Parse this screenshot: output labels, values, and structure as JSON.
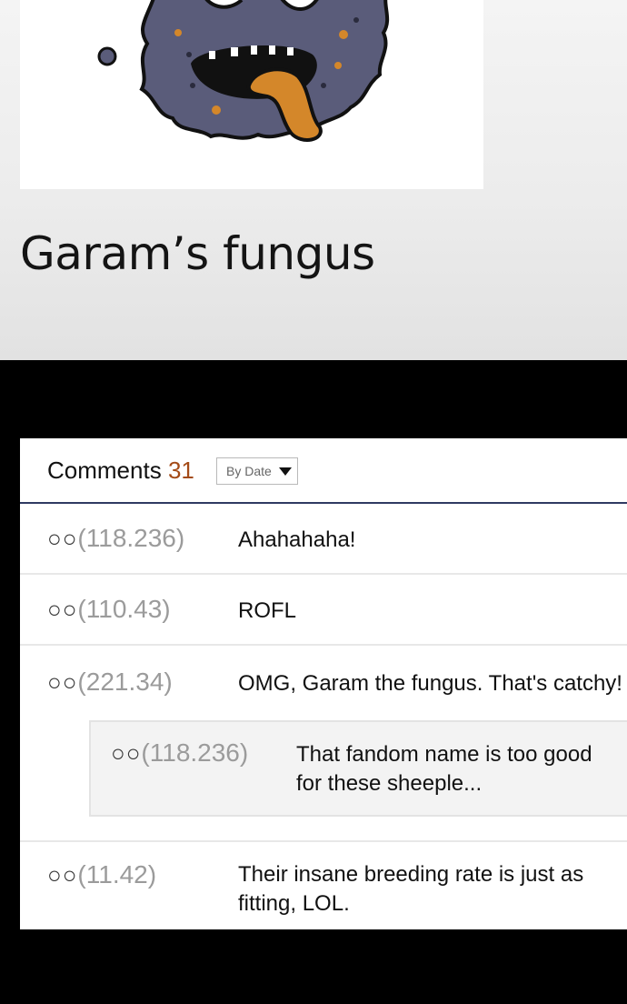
{
  "caption": "Garam’s fungus",
  "comments": {
    "title": "Comments",
    "count": "31",
    "sort_label": "By Date",
    "items": [
      {
        "circles": "○○",
        "author": "(118.236)",
        "text": "Ahahahaha!"
      },
      {
        "circles": "○○",
        "author": "(110.43)",
        "text": "ROFL"
      },
      {
        "circles": "○○",
        "author": "(221.34)",
        "text": "OMG, Garam the fungus. That's catchy!"
      },
      {
        "circles": "○○",
        "author": "(11.42)",
        "text": "Their insane breeding rate is just as fitting, LOL."
      }
    ],
    "reply": {
      "circles": "○○",
      "author": "(118.236)",
      "text": "That fandom name is too good for these sheeple..."
    }
  },
  "colors": {
    "count": "#a44b17",
    "divider": "#2f3a62",
    "fungus_body": "#5a5c7a",
    "tongue": "#d4872a"
  }
}
